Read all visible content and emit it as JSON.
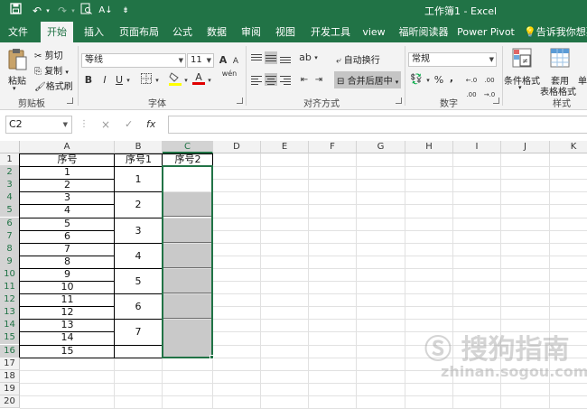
{
  "window": {
    "title": "工作簿1 - Excel"
  },
  "quick_access": {
    "save_icon": "save-icon",
    "undo_icon": "undo-icon",
    "redo_icon": "redo-icon",
    "preview_icon": "print-preview-icon",
    "sort_icon": "sort-icon",
    "more_icon": "customize-icon"
  },
  "tabs": [
    {
      "label": "文件"
    },
    {
      "label": "开始"
    },
    {
      "label": "插入"
    },
    {
      "label": "页面布局"
    },
    {
      "label": "公式"
    },
    {
      "label": "数据"
    },
    {
      "label": "审阅"
    },
    {
      "label": "视图"
    },
    {
      "label": "开发工具"
    },
    {
      "label": "view"
    },
    {
      "label": "福昕阅读器"
    },
    {
      "label": "Power Pivot"
    }
  ],
  "tell_me": "告诉我你想要",
  "ribbon": {
    "clipboard": {
      "paste": "粘贴",
      "cut": "剪切",
      "copy": "复制",
      "format_painter": "格式刷",
      "label": "剪贴板"
    },
    "font": {
      "name": "等线",
      "size": "11",
      "grow": "A",
      "shrink": "A",
      "bold": "B",
      "italic": "I",
      "underline": "U",
      "font_color": "A",
      "phonetic": "wén",
      "label": "字体"
    },
    "alignment": {
      "wrap": "自动换行",
      "merge": "合并后居中",
      "label": "对齐方式"
    },
    "number": {
      "format": "常规",
      "percent": "%",
      "comma": ",",
      "inc_decimal": "←.0 .00",
      "dec_decimal": ".00 →.0",
      "label": "数字"
    },
    "styles": {
      "conditional": "条件格式",
      "table1": "套用",
      "table2": "表格格式",
      "cell_style": "单",
      "label": "样式"
    }
  },
  "formula_bar": {
    "name_box": "C2",
    "cancel": "×",
    "confirm": "✓",
    "fx": "fx",
    "value": ""
  },
  "columns": [
    "A",
    "B",
    "C",
    "D",
    "E",
    "F",
    "G",
    "H",
    "I",
    "J",
    "K"
  ],
  "rows": [
    "1",
    "2",
    "3",
    "4",
    "5",
    "6",
    "7",
    "8",
    "9",
    "10",
    "11",
    "12",
    "13",
    "14",
    "15",
    "16",
    "17",
    "18",
    "19",
    "20"
  ],
  "sheet": {
    "header": {
      "a": "序号",
      "b": "序号1",
      "c": "序号2"
    },
    "col_a": [
      "1",
      "2",
      "3",
      "4",
      "5",
      "6",
      "7",
      "8",
      "9",
      "10",
      "11",
      "12",
      "13",
      "14",
      "15"
    ],
    "col_b": [
      "1",
      "2",
      "3",
      "4",
      "5",
      "6",
      "7"
    ]
  },
  "colors": {
    "accent": "#217346",
    "merged_fill": "#c9c9c9"
  }
}
